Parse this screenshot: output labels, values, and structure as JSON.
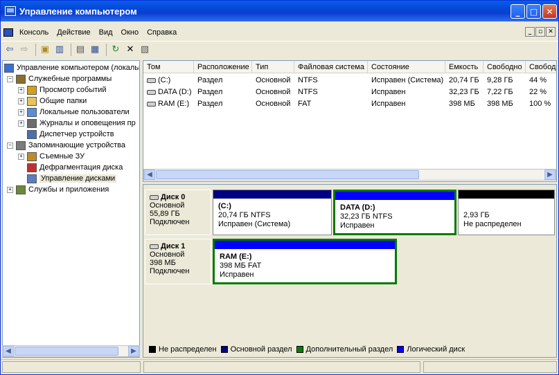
{
  "window": {
    "title": "Управление компьютером"
  },
  "menu": [
    "Консоль",
    "Действие",
    "Вид",
    "Окно",
    "Справка"
  ],
  "tree": [
    {
      "label": "Управление компьютером (локальны",
      "level": 0,
      "expander": "",
      "icon": "computer-icon",
      "color": "#3a6fd8"
    },
    {
      "label": "Служебные программы",
      "level": 1,
      "expander": "−",
      "icon": "tools-icon",
      "color": "#8b6d2f"
    },
    {
      "label": "Просмотр событий",
      "level": 2,
      "expander": "+",
      "icon": "event-viewer-icon",
      "color": "#d4a017"
    },
    {
      "label": "Общие папки",
      "level": 2,
      "expander": "+",
      "icon": "shared-folder-icon",
      "color": "#e8c35a"
    },
    {
      "label": "Локальные пользователи",
      "level": 2,
      "expander": "+",
      "icon": "users-icon",
      "color": "#5a8fd8"
    },
    {
      "label": "Журналы и оповещения пр",
      "level": 2,
      "expander": "+",
      "icon": "performance-logs-icon",
      "color": "#6d6d6d"
    },
    {
      "label": "Диспетчер устройств",
      "level": 2,
      "expander": "",
      "icon": "device-manager-icon",
      "color": "#4a6fb0"
    },
    {
      "label": "Запоминающие устройства",
      "level": 1,
      "expander": "−",
      "icon": "storage-icon",
      "color": "#7c7c7c"
    },
    {
      "label": "Съемные ЗУ",
      "level": 2,
      "expander": "+",
      "icon": "removable-storage-icon",
      "color": "#c08a2a"
    },
    {
      "label": "Дефрагментация диска",
      "level": 2,
      "expander": "",
      "icon": "defrag-icon",
      "color": "#c03030"
    },
    {
      "label": "Управление дисками",
      "level": 2,
      "expander": "",
      "icon": "disk-management-icon",
      "color": "#5b7ec0",
      "selected": true
    },
    {
      "label": "Службы и приложения",
      "level": 1,
      "expander": "+",
      "icon": "services-icon",
      "color": "#6a8a3a"
    }
  ],
  "volumes": {
    "columns": [
      "Том",
      "Расположение",
      "Тип",
      "Файловая система",
      "Состояние",
      "Емкость",
      "Свободно",
      "Свобод"
    ],
    "rows": [
      [
        "(C:)",
        "Раздел",
        "Основной",
        "NTFS",
        "Исправен (Система)",
        "20,74 ГБ",
        "9,28 ГБ",
        "44 %"
      ],
      [
        "DATA (D:)",
        "Раздел",
        "Основной",
        "NTFS",
        "Исправен",
        "32,23 ГБ",
        "7,22 ГБ",
        "22 %"
      ],
      [
        "RAM (E:)",
        "Раздел",
        "Основной",
        "FAT",
        "Исправен",
        "398 МБ",
        "398 МБ",
        "100 %"
      ]
    ]
  },
  "disks": [
    {
      "name": "Диск 0",
      "type": "Основной",
      "size": "55,89 ГБ",
      "status": "Подключен",
      "partitions": [
        {
          "name": "(C:)",
          "line2": "20,74 ГБ NTFS",
          "line3": "Исправен (Система)",
          "bar": "#000080",
          "selected": false
        },
        {
          "name": "DATA  (D:)",
          "line2": "32,23 ГБ NTFS",
          "line3": "Исправен",
          "bar": "#0000ff",
          "selected": true
        },
        {
          "name": "",
          "line2": "2,93 ГБ",
          "line3": "Не распределен",
          "bar": "#000000",
          "selected": false
        }
      ]
    },
    {
      "name": "Диск 1",
      "type": "Основной",
      "size": "398 МБ",
      "status": "Подключен",
      "partitions": [
        {
          "name": "RAM  (E:)",
          "line2": "398 МБ FAT",
          "line3": "Исправен",
          "bar": "#0000ff",
          "selected": true
        }
      ]
    }
  ],
  "legend": [
    {
      "label": "Не распределен",
      "color": "#000000"
    },
    {
      "label": "Основной раздел",
      "color": "#000080"
    },
    {
      "label": "Дополнительный раздел",
      "color": "#008000"
    },
    {
      "label": "Логический диск",
      "color": "#0000ff"
    }
  ],
  "colors": {
    "selection_border": "#007a00",
    "title_blue": "#0a3fd0"
  }
}
